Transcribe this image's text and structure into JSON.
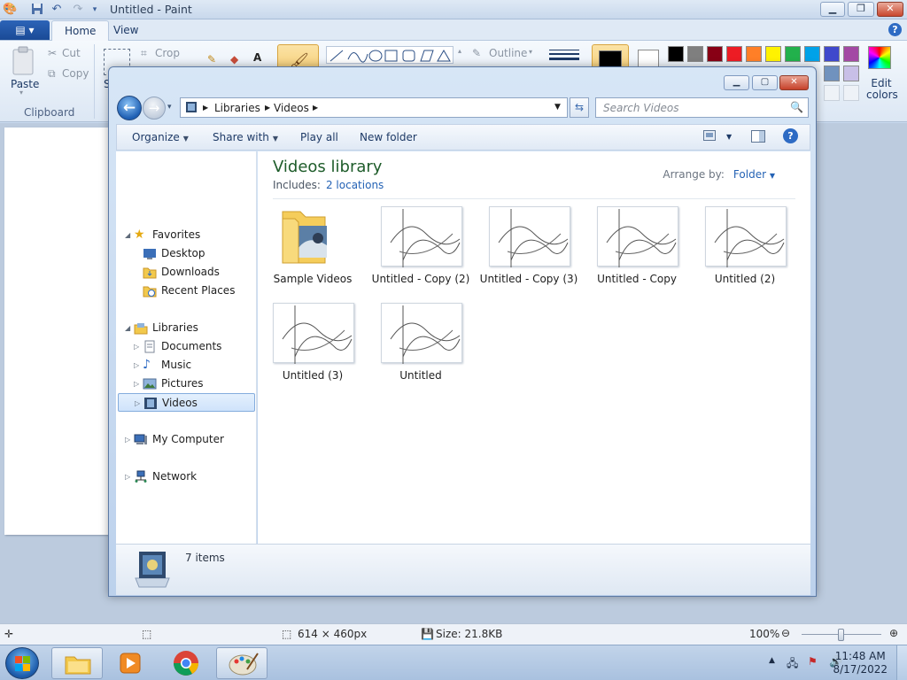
{
  "paint": {
    "title": "Untitled - Paint",
    "file_menu": "",
    "tabs": [
      "Home",
      "View"
    ],
    "clipboard": {
      "paste": "Paste",
      "cut": "Cut",
      "copy": "Copy",
      "group": "Clipboard"
    },
    "image": {
      "crop": "Crop",
      "select_partial": "S"
    },
    "shapes": {
      "outline": "Outline"
    },
    "edit_colors": "Edit colors",
    "palette": [
      "#000000",
      "#7f7f7f",
      "#880015",
      "#ed1c24",
      "#ff7f27",
      "#fff200",
      "#22b14c",
      "#00a2e8",
      "#3f48cc",
      "#a349a4"
    ],
    "palette_row2": [
      "#c8bfe7",
      "#7092be",
      "#e4e6eb",
      "#e4e6eb",
      "#e4e6eb"
    ],
    "status": {
      "dimensions": "614 × 460px",
      "size": "Size: 21.8KB",
      "zoom": "100%"
    }
  },
  "explorer": {
    "address": {
      "segments": [
        "Libraries",
        "Videos"
      ]
    },
    "search_placeholder": "Search Videos",
    "commands": {
      "organize": "Organize",
      "share_with": "Share with",
      "play_all": "Play all",
      "new_folder": "New folder"
    },
    "nav": {
      "favorites": "Favorites",
      "desktop": "Desktop",
      "downloads": "Downloads",
      "recent_places": "Recent Places",
      "libraries": "Libraries",
      "documents": "Documents",
      "music": "Music",
      "pictures": "Pictures",
      "videos": "Videos",
      "my_computer": "My Computer",
      "network": "Network"
    },
    "library": {
      "title": "Videos library",
      "includes_label": "Includes:",
      "locations": "2 locations",
      "arrange_by_label": "Arrange by:",
      "arrange_by_value": "Folder"
    },
    "items": [
      {
        "name": "Sample Videos",
        "kind": "folder"
      },
      {
        "name": "Untitled - Copy (2)",
        "kind": "image"
      },
      {
        "name": "Untitled - Copy (3)",
        "kind": "image"
      },
      {
        "name": "Untitled - Copy",
        "kind": "image"
      },
      {
        "name": "Untitled (2)",
        "kind": "image"
      },
      {
        "name": "Untitled (3)",
        "kind": "image"
      },
      {
        "name": "Untitled",
        "kind": "image"
      }
    ],
    "item_count": "7 items"
  },
  "taskbar": {
    "time": "11:48 AM",
    "date": "8/17/2022"
  }
}
